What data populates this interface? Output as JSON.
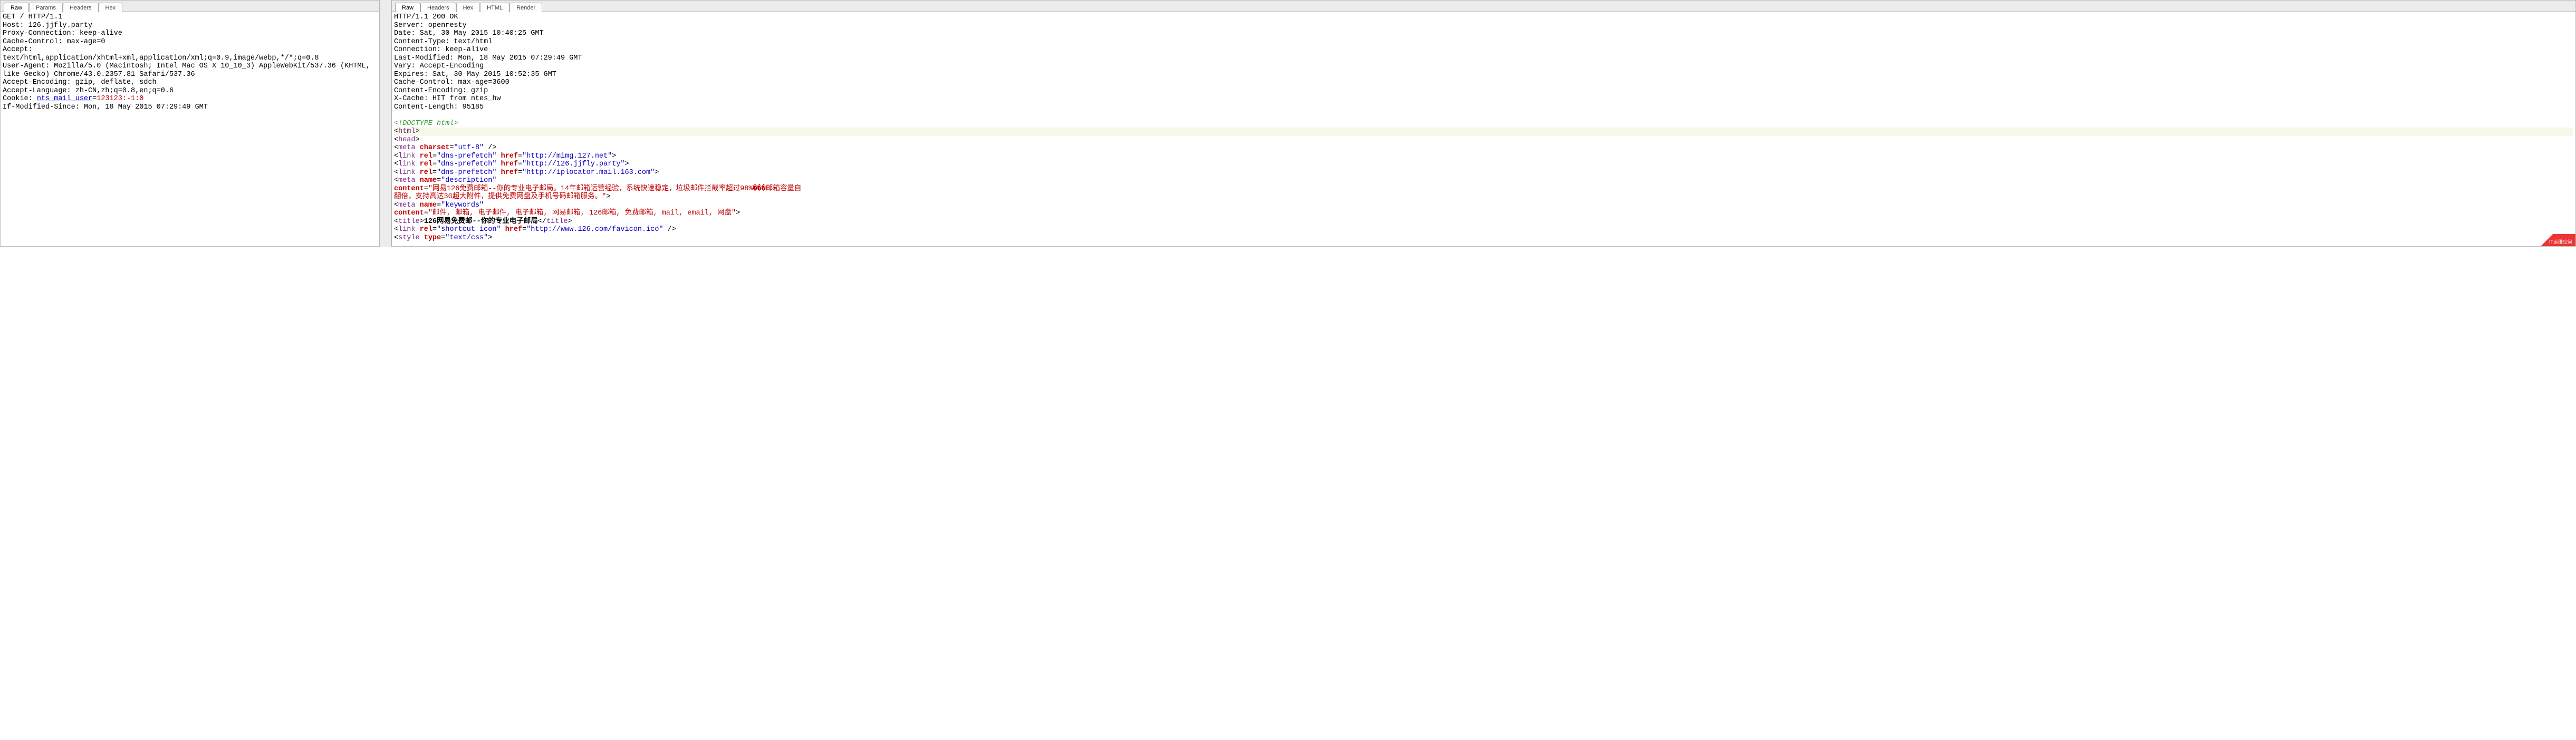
{
  "left": {
    "tabs": [
      {
        "label": "Raw",
        "active": true
      },
      {
        "label": "Params",
        "active": false
      },
      {
        "label": "Headers",
        "active": false
      },
      {
        "label": "Hex",
        "active": false
      }
    ],
    "request_line": "GET / HTTP/1.1",
    "headers": [
      "Host: 126.jjfly.party",
      "Proxy-Connection: keep-alive",
      "Cache-Control: max-age=0",
      "Accept:",
      "text/html,application/xhtml+xml,application/xml;q=0.9,image/webp,*/*;q=0.8",
      "User-Agent: Mozilla/5.0 (Macintosh; Intel Mac OS X 10_10_3) AppleWebKit/537.36 (KHTML, like Gecko) Chrome/43.0.2357.81 Safari/537.36",
      "Accept-Encoding: gzip, deflate, sdch",
      "Accept-Language: zh-CN,zh;q=0.8,en;q=0.6"
    ],
    "cookie_prefix": "Cookie: ",
    "cookie_name": "nts_mail_user",
    "cookie_eq": "=",
    "cookie_value": "123123:-1:0",
    "after_cookie": "If-Modified-Since: Mon, 18 May 2015 07:29:49 GMT"
  },
  "right": {
    "tabs": [
      {
        "label": "Raw",
        "active": true
      },
      {
        "label": "Headers",
        "active": false
      },
      {
        "label": "Hex",
        "active": false
      },
      {
        "label": "HTML",
        "active": false
      },
      {
        "label": "Render",
        "active": false
      }
    ],
    "status_line": "HTTP/1.1 200 OK",
    "headers": [
      "Server: openresty",
      "Date: Sat, 30 May 2015 10:40:25 GMT",
      "Content-Type: text/html",
      "Connection: keep-alive",
      "Last-Modified: Mon, 18 May 2015 07:29:49 GMT",
      "Vary: Accept-Encoding",
      "Expires: Sat, 30 May 2015 10:52:35 GMT",
      "Cache-Control: max-age=3600",
      "Content-Encoding: gzip",
      "X-Cache: HIT from ntes_hw",
      "Content-Length: 95185"
    ],
    "doctype": "<!DOCTYPE html>",
    "html_open": "html",
    "head_open": "head",
    "meta_charset_attr": "charset",
    "meta_charset_val": "\"utf-8\"",
    "link_rel_attr": "rel",
    "link_href_attr": "href",
    "dns_prefetch": "\"dns-prefetch\"",
    "links": [
      "\"http://mimg.127.net\"",
      "\"http://126.jjfly.party\"",
      "\"http://iplocator.mail.163.com\""
    ],
    "meta_name_attr": "name",
    "meta_desc_val": "\"description\"",
    "content_attr": "content",
    "desc_content": "\"网易126免费邮箱--你的专业电子邮局。14年邮箱运营经验，系统快速稳定，垃圾邮件拦截率超过98%���邮箱容量自\n翻倍，支持高达3G超大附件，提供免费网盘及手机号码邮箱服务。\"",
    "meta_kw_val": "\"keywords\"",
    "kw_content": "\"邮件, 邮箱, 电子邮件, 电子邮箱, 网易邮箱, 126邮箱, 免费邮箱, mail, email, 网盘\"",
    "title_tag": "title",
    "title_body": "126网易免费邮--你的专业电子邮局",
    "favicon_rel": "\"shortcut icon\"",
    "favicon_href": "\"http://www.126.com/favicon.ico\"",
    "style_tag": "style",
    "style_type_attr": "type",
    "style_type_val": "\"text/css\""
  },
  "watermark": "IT运维空间"
}
